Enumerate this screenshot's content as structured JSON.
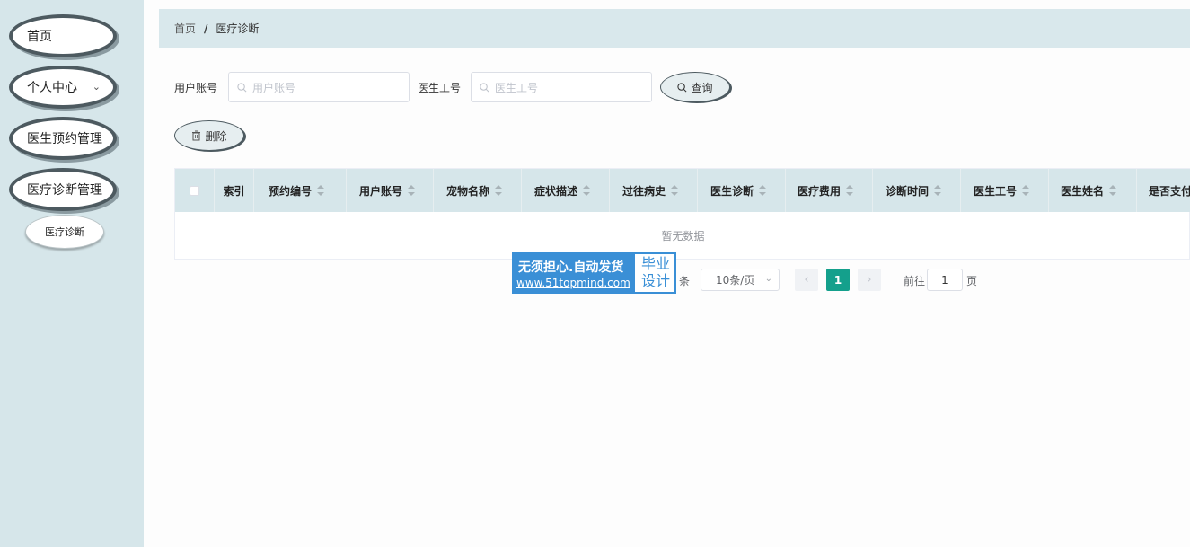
{
  "sidebar": {
    "items": [
      {
        "label": "首页"
      },
      {
        "label": "个人中心"
      },
      {
        "label": "医生预约管理"
      },
      {
        "label": "医疗诊断管理"
      }
    ],
    "sub_item": "医疗诊断"
  },
  "breadcrumb": {
    "home": "首页",
    "separator": "/",
    "current": "医疗诊断"
  },
  "search": {
    "user_label": "用户账号",
    "user_placeholder": "用户账号",
    "doctor_label": "医生工号",
    "doctor_placeholder": "医生工号",
    "query_button": "查询"
  },
  "toolbar": {
    "delete_button": "删除"
  },
  "table": {
    "columns": [
      "索引",
      "预约编号",
      "用户账号",
      "宠物名称",
      "症状描述",
      "过往病史",
      "医生诊断",
      "医疗费用",
      "诊断时间",
      "医生工号",
      "医生姓名",
      "是否支付"
    ],
    "empty_text": "暂无数据"
  },
  "pagination": {
    "total_suffix": "条",
    "page_size": "10条/页",
    "current_page": "1",
    "goto_label": "前往",
    "goto_value": "1",
    "page_suffix": "页"
  },
  "watermark": {
    "line1": "无须担心.自动发货",
    "line2": "www.51topmind.com",
    "right1": "毕业",
    "right2": "设计"
  },
  "colors": {
    "sidebar_bg": "#d6e6ea",
    "accent": "#14a08c",
    "pill_border": "#4d5a60"
  }
}
